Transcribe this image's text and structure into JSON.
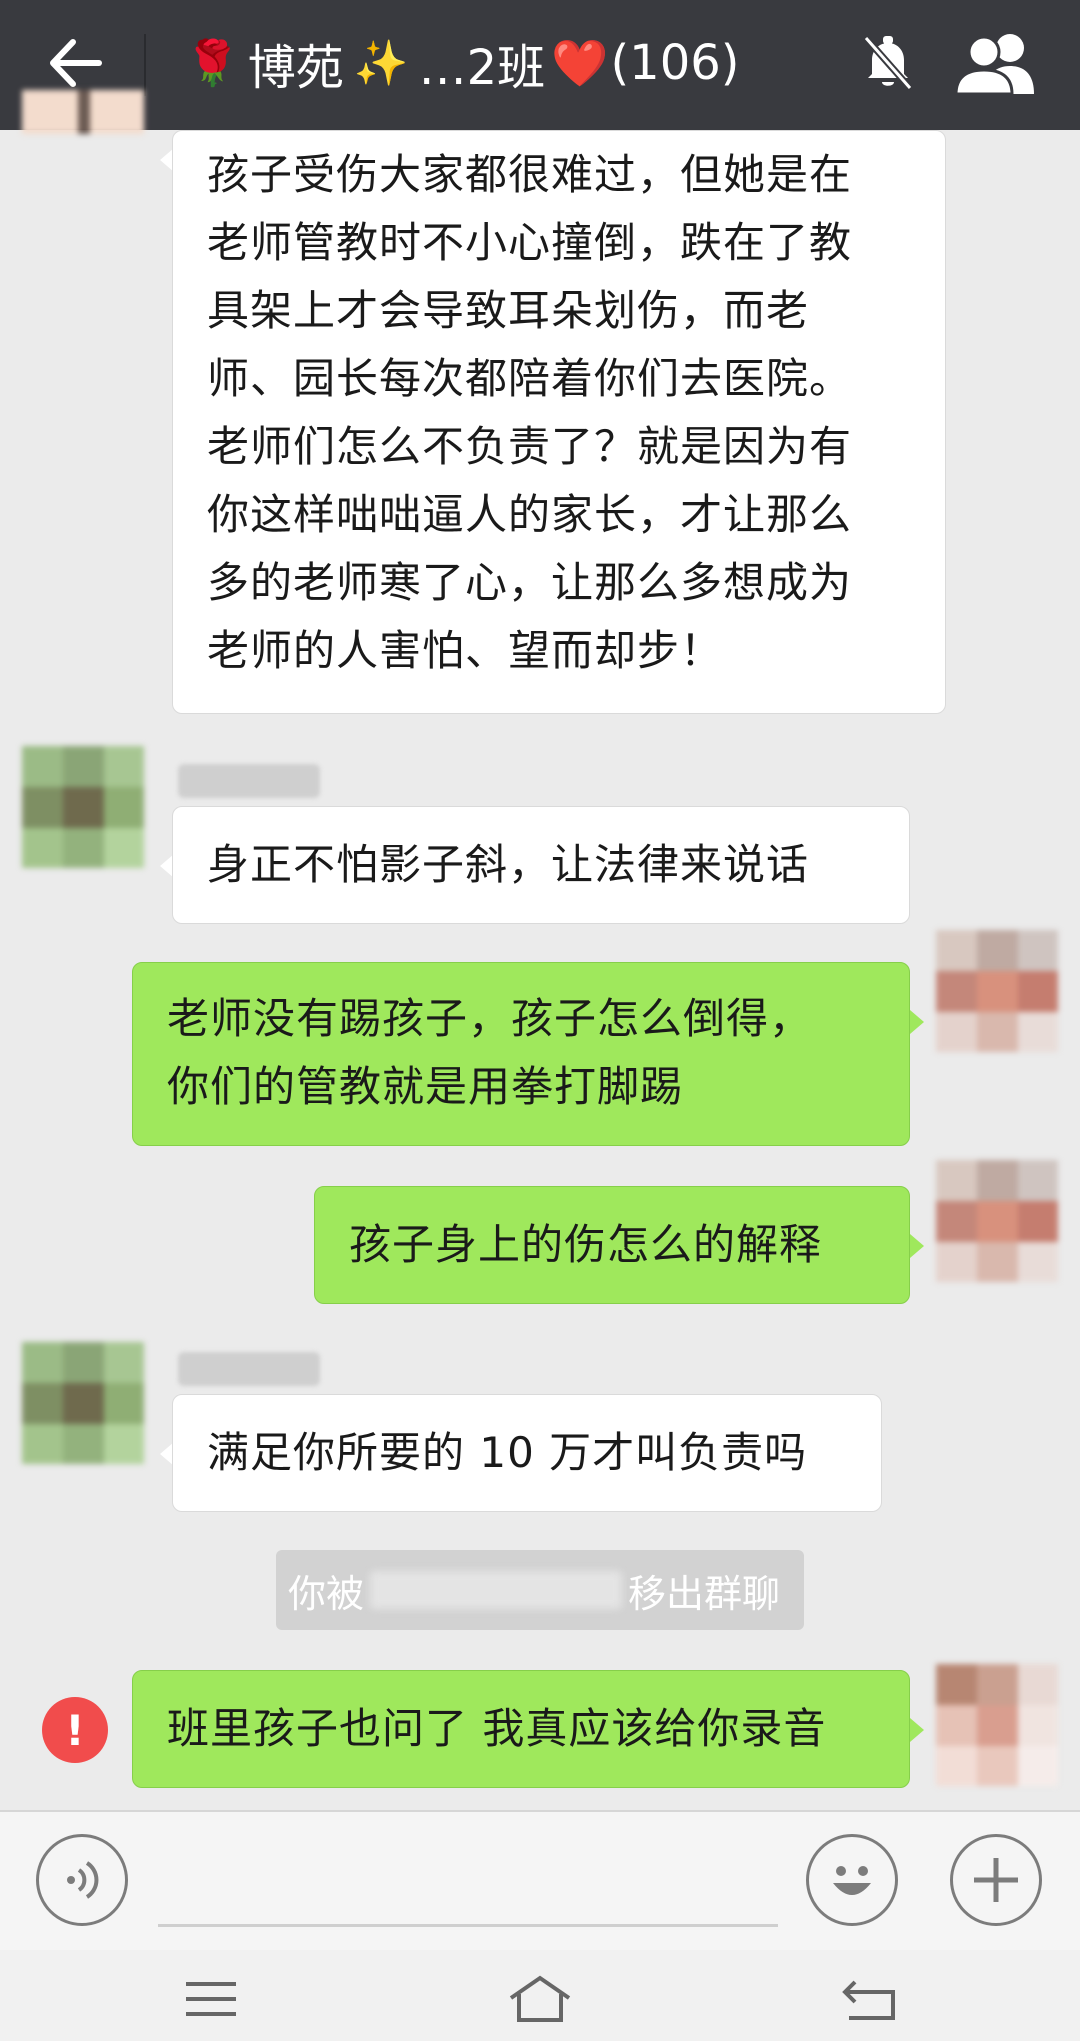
{
  "header": {
    "title_name": "博苑",
    "title_suffix": "…2班",
    "member_count": "(106)"
  },
  "messages": [
    {
      "side": "left",
      "text": "孩子受伤大家都很难过，但她是在\n老师管教时不小心撞倒，跌在了教\n具架上才会导致耳朵划伤，而老\n师、园长每次都陪着你们去医院。\n老师们怎么不负责了？就是因为有\n你这样咄咄逼人的家长，才让那么\n多的老师寒了心，让那么多想成为\n老师的人害怕、望而却步！"
    },
    {
      "side": "left",
      "text": "身正不怕影子斜，让法律来说话"
    },
    {
      "side": "right",
      "text": "老师没有踢孩子，孩子怎么倒得，\n你们的管教就是用拳打脚踢"
    },
    {
      "side": "right",
      "text": "孩子身上的伤怎么的解释"
    },
    {
      "side": "left",
      "text": "满足你所要的 10 万才叫负责吗"
    },
    {
      "side": "right",
      "text": "班里孩子也问了 我真应该给你录音"
    }
  ],
  "system_message": {
    "prefix": "你被",
    "suffix": "移出群聊"
  },
  "error_icon_glyph": "!",
  "colors": {
    "header_bg": "#393a3f",
    "chat_bg": "#ebebeb",
    "bubble_self": "#9fe85c",
    "bubble_other": "#ffffff",
    "error": "#f14c4c"
  },
  "icons": [
    "back-arrow-icon",
    "rose-icon",
    "sparkles-icon",
    "heart-icon",
    "mute-icon",
    "members-icon",
    "voice-icon",
    "emoji-icon",
    "plus-icon",
    "menu-icon",
    "home-icon",
    "return-icon"
  ]
}
